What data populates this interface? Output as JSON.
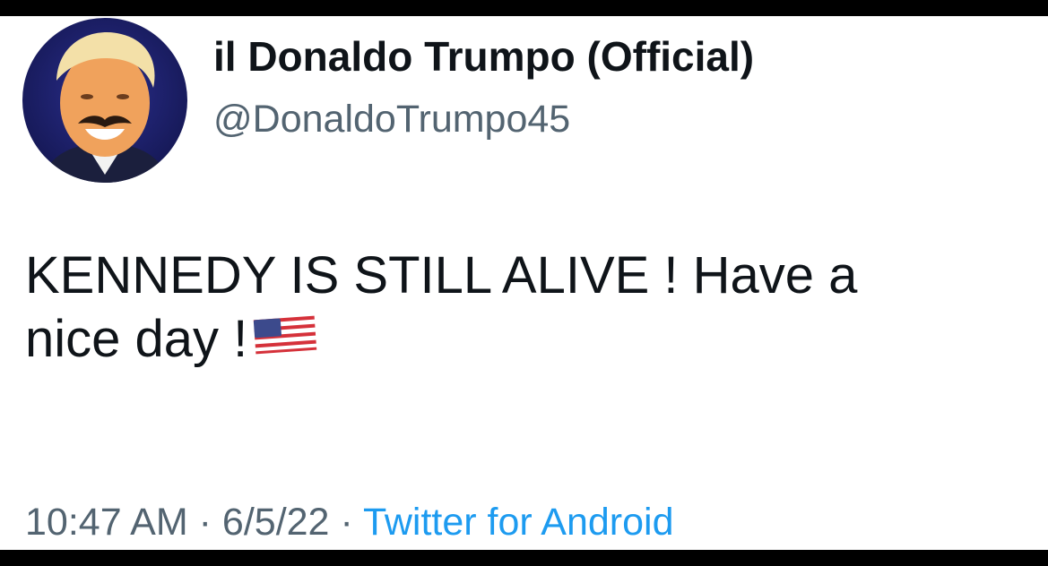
{
  "tweet": {
    "author": {
      "display_name": "il Donaldo Trumpo (Official)",
      "handle": "@DonaldoTrumpo45",
      "avatar_icon": "profile-photo"
    },
    "text_line_1": "KENNEDY IS STILL ALIVE ! Have a",
    "text_line_2": "nice day !",
    "emoji": "us-flag-icon",
    "timestamp_time": "10:47 AM",
    "separator": "·",
    "timestamp_date": "6/5/22",
    "source": "Twitter for Android"
  },
  "colors": {
    "text_primary": "#0f1419",
    "text_secondary": "#536471",
    "link": "#1d9bf0",
    "frame_border": "#000000"
  }
}
